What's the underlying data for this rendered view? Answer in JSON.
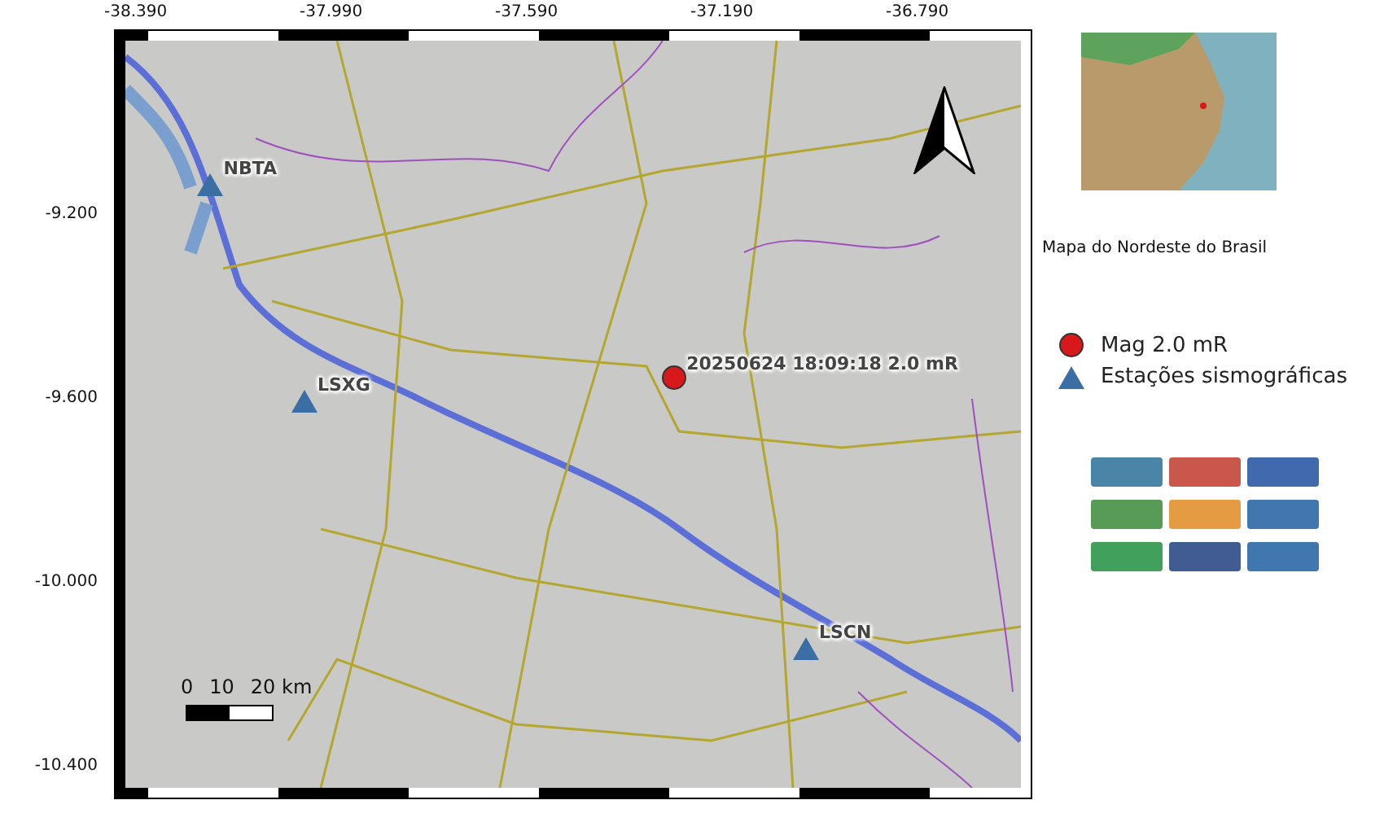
{
  "map": {
    "x_ticks": [
      "-38.390",
      "-37.990",
      "-37.590",
      "-37.190",
      "-36.790"
    ],
    "y_ticks": [
      "-9.200",
      "-9.600",
      "-10.000",
      "-10.400"
    ],
    "stations": [
      {
        "code": "NBTA"
      },
      {
        "code": "LSXG"
      },
      {
        "code": "LSCN"
      }
    ],
    "event": {
      "label": "20250624 18:09:18 2.0 mR"
    },
    "scale_bar": {
      "labels": [
        "0",
        "10",
        "20 km"
      ]
    }
  },
  "inset": {
    "caption": "Mapa do  Nordeste do Brasil"
  },
  "legend": [
    {
      "kind": "circle",
      "label": "Mag 2.0 mR",
      "color": "#d7191c"
    },
    {
      "kind": "triangle",
      "label": "Estações sismográficas",
      "color": "#3a6ea5"
    }
  ]
}
